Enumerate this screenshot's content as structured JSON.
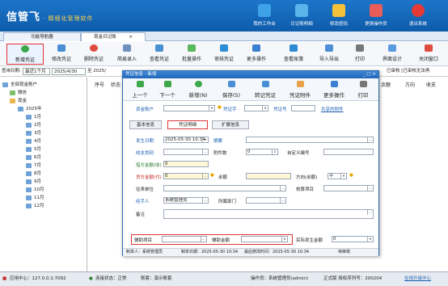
{
  "header": {
    "logo": "信管飞",
    "tagline": "· 精细化管理软件",
    "icons": [
      {
        "label": "我的工作台",
        "color": "#3ea2e8"
      },
      {
        "label": "日记账明细",
        "color": "#5ab4ea"
      },
      {
        "label": "修改密码",
        "color": "#f3c13a"
      },
      {
        "label": "更换操作员",
        "color": "#e85d58"
      },
      {
        "label": "退出系统",
        "color": "#e53935"
      }
    ]
  },
  "tabs": [
    {
      "label": "功能导航器"
    },
    {
      "label": "现金日记账",
      "close": "×"
    }
  ],
  "toolbar": [
    {
      "label": "新增凭证",
      "color": "#3da84a"
    },
    {
      "label": "修改凭证",
      "color": "#4a8fd6"
    },
    {
      "label": "删除凭证",
      "color": "#e04b3f"
    },
    {
      "label": "简易录入",
      "color": "#6f8fbf"
    },
    {
      "label": "查看凭证",
      "color": "#4a8fd6"
    },
    {
      "label": "批量操作",
      "color": "#5cb85c"
    },
    {
      "label": "审核凭证",
      "color": "#2e8bd6"
    },
    {
      "label": "更多操作",
      "color": "#3b7fd0"
    },
    {
      "label": "查看账簿",
      "color": "#2c8bd3"
    },
    {
      "label": "导入导出",
      "color": "#4a8fd6"
    },
    {
      "label": "打印",
      "color": "#777"
    },
    {
      "label": "界面设计",
      "color": "#5a9be0"
    },
    {
      "label": "关闭窗口",
      "color": "#e04b3f"
    }
  ],
  "query": {
    "label": "查询日期:",
    "period": "最近1个月",
    "from": "2025/4/30",
    "to": "至 2025/",
    "right": "已审核 [已审核无法再",
    "dirs": [
      "余额",
      "方向",
      "收支"
    ]
  },
  "tree": {
    "root": "全部现金账户",
    "nodes": [
      "微信",
      "现金",
      "2025年",
      "1月",
      "2月",
      "3月",
      "4月",
      "5月",
      "6月",
      "7月",
      "8月",
      "9月",
      "10月",
      "11月",
      "12月"
    ]
  },
  "grid": {
    "headers": [
      "序号",
      "状态"
    ]
  },
  "dialog": {
    "title": "凭证信息 - 新增",
    "toolbar": [
      "上一个",
      "下一个",
      "新增(N)",
      "保存(S)",
      "转记凭证",
      "凭证附件",
      "更多操作",
      "打印"
    ],
    "fields": {
      "account_label": "资金账户",
      "voucher_word": "凭证字",
      "voucher_no_label": "凭证号",
      "share": "共享的附件",
      "tab_basic": "基本信息",
      "tab_detail": "凭证明细",
      "tab_ext": "扩展信息",
      "date_label": "发生日期",
      "date_value": "2025-05-30 10:34",
      "summary_label": "摘要",
      "category_label": "收支类别",
      "attach_label": "附件数",
      "attach_value": "0",
      "custom_no_label": "自定义编号",
      "debit_label": "借方金额(收)",
      "debit_value": "0",
      "credit_label": "贷方金额(付)",
      "credit_value": "0",
      "balance_label": "余额",
      "direction_label": "方向(余额)",
      "direction_value": "平",
      "partner_label": "往来单位",
      "item_label": "核算项目",
      "handler_label": "经手人",
      "handler_value": "系统管理员",
      "dept_label": "所属部门",
      "note_label": "备注",
      "aux_label": "辅助项目",
      "aux_amount_label": "辅助金额",
      "actual_label": "实际发生金额",
      "actual_value": "0"
    },
    "footer": {
      "creator": "制单人：系统管理员",
      "created": "制单日期：2025-05-30 10:34",
      "modified": "最后修改时间：2025-05-30 10:34",
      "audit": "待审核"
    }
  },
  "status": {
    "center": "应用中心：127.0.0.1:7092",
    "conn": "连接状态：正常",
    "account": "账套：演示账套",
    "operator": "操作员：系统管理员(admin)",
    "license": "正式版 授权序列号：200204",
    "update": "在线升级中心"
  }
}
